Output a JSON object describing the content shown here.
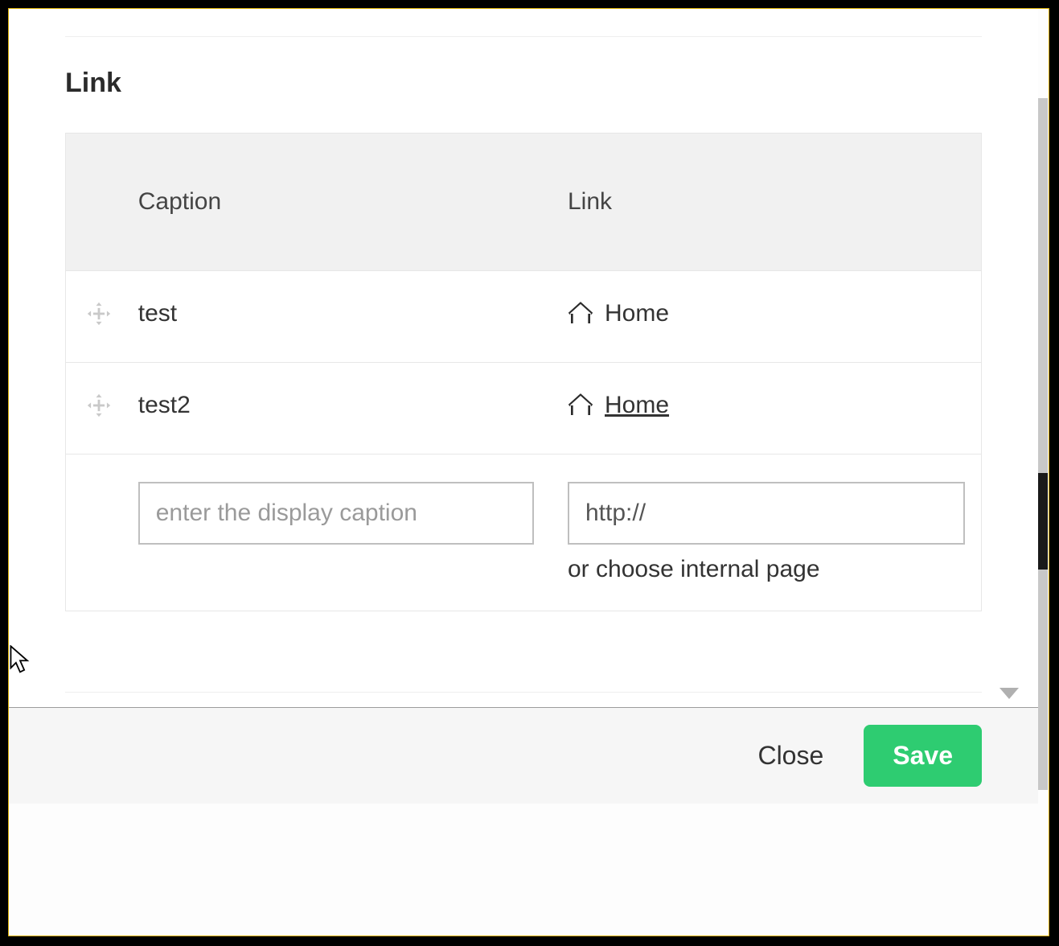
{
  "section": {
    "title": "Link"
  },
  "table": {
    "headers": {
      "caption": "Caption",
      "link": "Link"
    },
    "rows": [
      {
        "caption": "test",
        "link_label": "Home",
        "underline": false
      },
      {
        "caption": "test2",
        "link_label": "Home",
        "underline": true
      }
    ],
    "input_row": {
      "caption_placeholder": "enter the display caption",
      "url_placeholder": "http://",
      "helper_text": "or choose internal page"
    }
  },
  "footer": {
    "close_label": "Close",
    "save_label": "Save"
  },
  "colors": {
    "accent_green": "#2ecc71",
    "teal": "#1abc9c"
  }
}
